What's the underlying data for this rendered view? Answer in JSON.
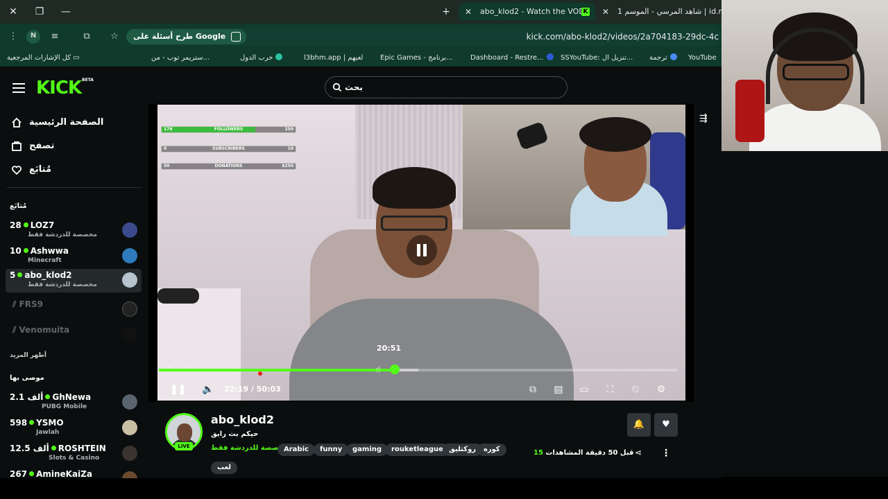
{
  "browser": {
    "tabs": [
      {
        "title": "abo_klod2 - Watch the VOD",
        "active": true
      },
      {
        "title": "شاهد المرسي - الموسم 1 | id.net",
        "active": false
      }
    ],
    "omnibox": {
      "google_chip": "طرح أسئلة على Google",
      "url": "kick.com/abo-klod2/videos/2a704183-29dc-4c"
    },
    "bookmarks": {
      "all_bookmarks": "كل الإشارات المرجعية",
      "items": [
        "YouTube",
        "ترجمة",
        "SSYouTube: تنزيل ال...",
        "Dashboard - Restre...",
        "Epic Games - برنامج...",
        "l3bhm.app | لعبهم",
        "حرب الدول",
        "ستريمر توب - من..."
      ]
    },
    "profile_initial": "N"
  },
  "kick": {
    "logo": "KICK",
    "logo_badge": "BETA",
    "search_placeholder": "بحث",
    "nav": {
      "home": "الصفحة الرئيسية",
      "browse": "تصفح",
      "following": "مُتابَع"
    },
    "following_title": "مُتابَع",
    "following": [
      {
        "count": "28",
        "name": "LOZ7",
        "sub": "مخصصة للدردشة فقط",
        "live": true,
        "selected": false
      },
      {
        "count": "10",
        "name": "Ashwwa",
        "sub": "Minecraft",
        "live": true,
        "selected": false
      },
      {
        "count": "5",
        "name": "abo_klod2",
        "sub": "مخصصة للدردشة فقط",
        "live": true,
        "selected": true
      },
      {
        "count": "",
        "name": "FRS9",
        "sub": "",
        "live": false,
        "selected": false
      },
      {
        "count": "",
        "name": "Venomuita",
        "sub": "",
        "live": false,
        "selected": false
      }
    ],
    "show_more": "أظهر المزيد",
    "recommended_title": "موصى بها",
    "recommended": [
      {
        "count": "2.1 ألف",
        "name": "GhNewa",
        "sub": "PUBG Mobile"
      },
      {
        "count": "598",
        "name": "YSMO",
        "sub": "Jawlah"
      },
      {
        "count": "12.5 ألف",
        "name": "ROSHTEIN",
        "sub": "Slots & Casino"
      },
      {
        "count": "267",
        "name": "AmineKaiZa",
        "sub": ""
      }
    ]
  },
  "player": {
    "overlay_stats": [
      {
        "left": "176",
        "label": "FOLLOWERS",
        "right": "250",
        "fill": 0.7
      },
      {
        "left": "0",
        "label": "SUBSCRIBERS",
        "right": "10",
        "fill": 0
      },
      {
        "left": "50",
        "label": "DONATIONS",
        "right": "$250",
        "fill": 0
      }
    ],
    "hover_time": "20:51",
    "current_time": "22:19",
    "separator": "/",
    "duration": "50:03",
    "played_fraction": 0.455,
    "buffered_fraction": 0.5
  },
  "channel": {
    "name": "abo_klod2",
    "live_badge": "LIVE",
    "title": "حيكم بث رايق",
    "category": "مخصصة للدردشة فقط",
    "tags": [
      "Arabic",
      "funny",
      "gaming",
      "rouketleague",
      "روكتليق",
      "كوره",
      "لعب"
    ],
    "views_count": "15",
    "views_label": "المشاهدات",
    "time_ago": "قبل 50 دقيقة"
  },
  "colors": {
    "accent": "#53fc18",
    "chrome_dark": "#0f3a2c",
    "page_bg": "#0b0e0f"
  }
}
